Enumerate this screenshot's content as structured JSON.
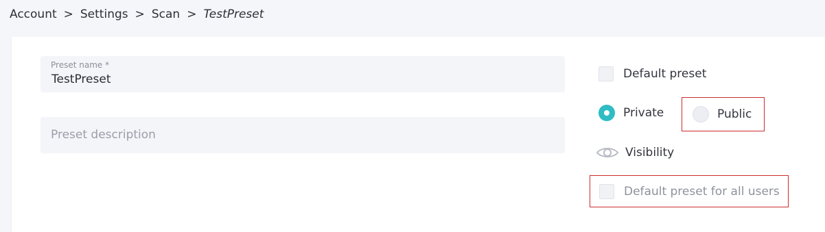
{
  "breadcrumb": {
    "items": [
      "Account",
      "Settings",
      "Scan",
      "TestPreset"
    ],
    "separator": ">"
  },
  "form": {
    "preset_name": {
      "label": "Preset name *",
      "value": "TestPreset"
    },
    "preset_description": {
      "placeholder": "Preset description",
      "value": ""
    }
  },
  "options": {
    "default_preset_label": "Default preset",
    "default_preset_checked": false,
    "private_label": "Private",
    "private_selected": true,
    "public_label": "Public",
    "public_selected": false,
    "visibility_label": "Visibility",
    "visibility_icon": "eye-icon",
    "default_all_users_label": "Default preset for all users",
    "default_all_users_checked": false,
    "default_all_users_disabled": true
  },
  "colors": {
    "accent": "#2fbcc4",
    "highlight_border": "#cc2a2a",
    "page_background": "#f5f6fa",
    "panel_background": "#ffffff"
  }
}
